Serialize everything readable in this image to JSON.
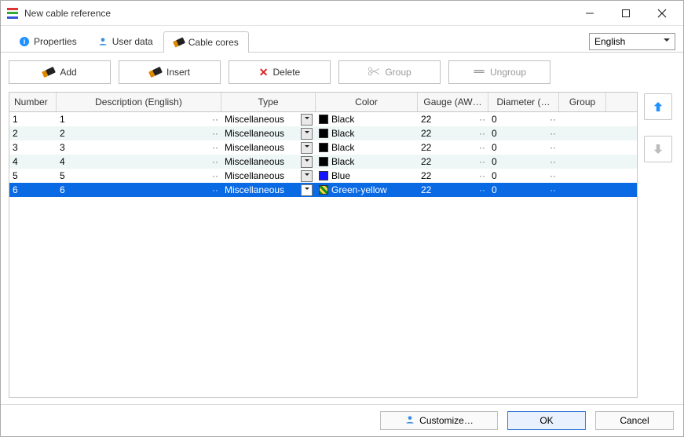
{
  "window": {
    "title": "New cable reference"
  },
  "tabs": {
    "properties": "Properties",
    "userdata": "User data",
    "cablecores": "Cable cores"
  },
  "language": {
    "selected": "English"
  },
  "toolbar": {
    "add": "Add",
    "insert": "Insert",
    "delete": "Delete",
    "group": "Group",
    "ungroup": "Ungroup"
  },
  "columns": {
    "number": "Number",
    "description": "Description (English)",
    "type": "Type",
    "color": "Color",
    "gauge": "Gauge (AW…",
    "diameter": "Diameter (…",
    "group": "Group"
  },
  "rows": [
    {
      "num": "1",
      "desc": "1",
      "type": "Miscellaneous",
      "color": "Black",
      "swatch": "#000",
      "gauge": "22",
      "diameter": "0",
      "group": "",
      "sel": false
    },
    {
      "num": "2",
      "desc": "2",
      "type": "Miscellaneous",
      "color": "Black",
      "swatch": "#000",
      "gauge": "22",
      "diameter": "0",
      "group": "",
      "sel": false
    },
    {
      "num": "3",
      "desc": "3",
      "type": "Miscellaneous",
      "color": "Black",
      "swatch": "#000",
      "gauge": "22",
      "diameter": "0",
      "group": "",
      "sel": false
    },
    {
      "num": "4",
      "desc": "4",
      "type": "Miscellaneous",
      "color": "Black",
      "swatch": "#000",
      "gauge": "22",
      "diameter": "0",
      "group": "",
      "sel": false
    },
    {
      "num": "5",
      "desc": "5",
      "type": "Miscellaneous",
      "color": "Blue",
      "swatch": "#1414ff",
      "gauge": "22",
      "diameter": "0",
      "group": "",
      "sel": false
    },
    {
      "num": "6",
      "desc": "6",
      "type": "Miscellaneous",
      "color": "Green-yellow",
      "swatch": "gy",
      "gauge": "22",
      "diameter": "0",
      "group": "",
      "sel": true
    }
  ],
  "footer": {
    "customize": "Customize…",
    "ok": "OK",
    "cancel": "Cancel"
  }
}
